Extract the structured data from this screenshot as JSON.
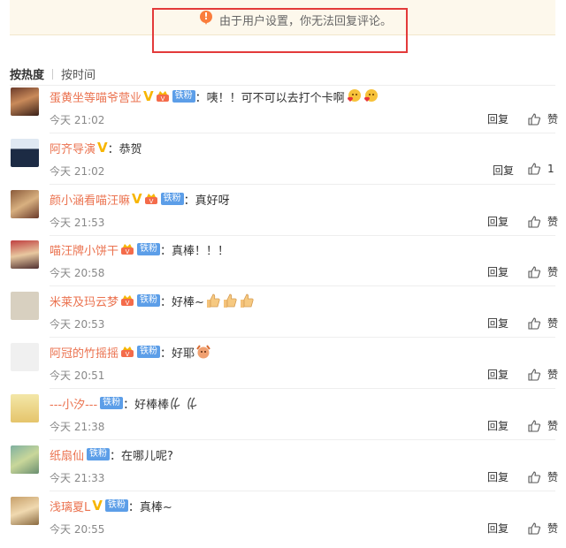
{
  "notice": {
    "icon": "warning-icon",
    "text": "由于用户设置，你无法回复评论。"
  },
  "sort": {
    "hot": "按热度",
    "time": "按时间"
  },
  "comments": [
    {
      "user": "蛋黄坐等喵爷营业",
      "vip": true,
      "crown": true,
      "fan": "铁粉",
      "text": "咦！！可不可以去打个卡啊",
      "emojis": [
        "heart-kiss-emoji",
        "heart-kiss-emoji"
      ],
      "time": "今天 21:02",
      "reply": "回复",
      "like": "赞"
    },
    {
      "user": "阿齐导演",
      "vip": true,
      "crown": false,
      "fan": "",
      "text": "恭贺",
      "emojis": [],
      "time": "今天 21:02",
      "reply": "回复",
      "like": "1"
    },
    {
      "user": "颜小涵看喵汪嘛",
      "vip": true,
      "crown": true,
      "fan": "铁粉",
      "text": "真好呀",
      "emojis": [],
      "time": "今天 21:53",
      "reply": "回复",
      "like": "赞"
    },
    {
      "user": "喵汪牌小饼干",
      "vip": false,
      "crown": true,
      "fan": "铁粉",
      "text": "真棒！！！",
      "emojis": [],
      "time": "今天 20:58",
      "reply": "回复",
      "like": "赞"
    },
    {
      "user": "米莱及玛云梦",
      "vip": false,
      "crown": true,
      "fan": "铁粉",
      "text": "好棒~",
      "emojis": [
        "thumbs-up-emoji",
        "thumbs-up-emoji",
        "thumbs-up-emoji"
      ],
      "time": "今天 20:53",
      "reply": "回复",
      "like": "赞"
    },
    {
      "user": "阿冠的竹摇摇",
      "vip": false,
      "crown": true,
      "fan": "铁粉",
      "text": "好耶",
      "emojis": [
        "cheer-emoji"
      ],
      "time": "今天 20:51",
      "reply": "回复",
      "like": "赞"
    },
    {
      "user": "---小汐---",
      "vip": false,
      "crown": false,
      "fan": "铁粉",
      "text": "好棒棒",
      "emojis": [
        "clap-emoji",
        "clap-emoji"
      ],
      "time": "今天 21:38",
      "reply": "回复",
      "like": "赞"
    },
    {
      "user": "纸扇仙",
      "vip": false,
      "crown": false,
      "fan": "铁粉",
      "text": "在哪儿呢?",
      "emojis": [],
      "time": "今天 21:33",
      "reply": "回复",
      "like": "赞"
    },
    {
      "user": "浅璃夏L",
      "vip": true,
      "crown": false,
      "fan": "铁粉",
      "text": "真棒~",
      "emojis": [],
      "time": "今天 20:55",
      "reply": "回复",
      "like": "赞"
    }
  ],
  "colors": {
    "username": "#eb7350",
    "fan_badge": "#5c9ee8",
    "vip": "#f7b500",
    "notice_bg": "#fdf8ec",
    "annotation": "#e33a3a"
  }
}
